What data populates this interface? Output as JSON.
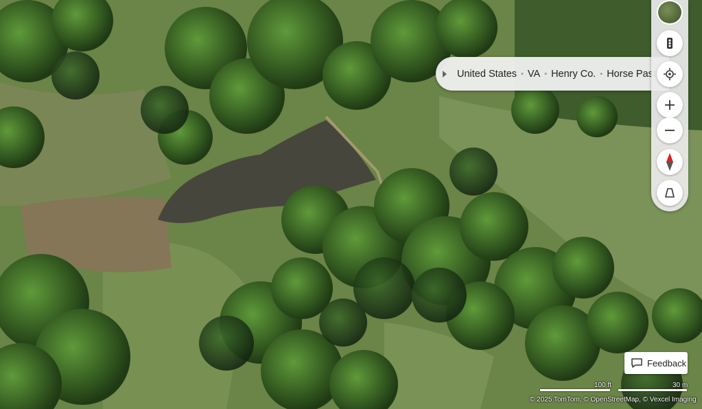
{
  "breadcrumb": {
    "items": [
      "United States",
      "VA",
      "Henry Co.",
      "Horse Pasture"
    ]
  },
  "toolbar": {
    "buttons": [
      {
        "name": "traffic-button",
        "icon": "traffic-light-icon"
      },
      {
        "name": "locate-me-button",
        "icon": "locate-icon"
      },
      {
        "name": "zoom-in-button",
        "icon": "plus-icon"
      },
      {
        "name": "zoom-out-button",
        "icon": "minus-icon"
      },
      {
        "name": "compass-button",
        "icon": "compass-icon"
      },
      {
        "name": "tilt-button",
        "icon": "3d-tilt-icon"
      }
    ],
    "map_style_thumbnail": "aerial"
  },
  "feedback": {
    "label": "Feedback"
  },
  "scale": {
    "imperial": "100 ft",
    "metric": "30 m"
  },
  "attribution": "© 2025 TomTom, © OpenStreetMap, © Vexcel Imaging",
  "colors": {
    "compass_north": "#e0201b",
    "pond": "#4a4a40",
    "pasture": "#6f8a4a"
  }
}
